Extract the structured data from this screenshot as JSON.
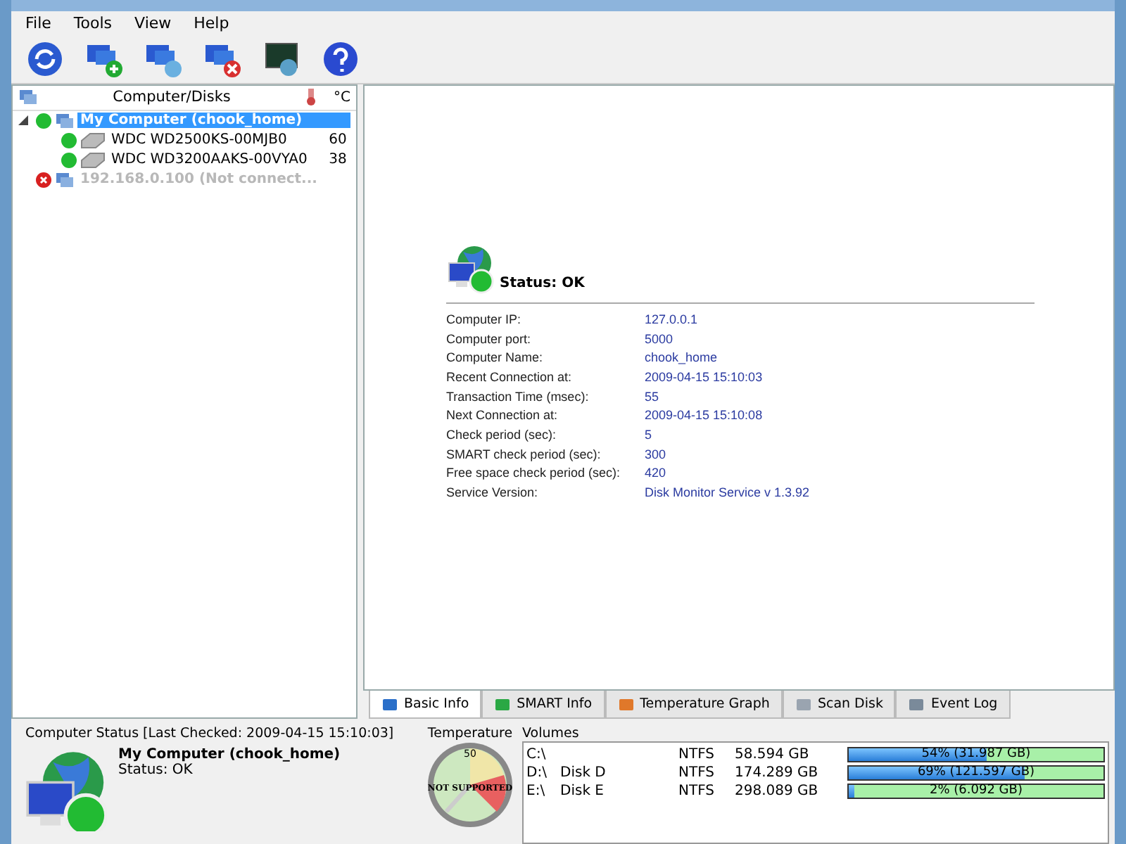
{
  "menu": [
    "File",
    "Tools",
    "View",
    "Help"
  ],
  "toolbar": [
    {
      "kind": "refresh"
    },
    {
      "kind": "add"
    },
    {
      "kind": "edit"
    },
    {
      "kind": "remove"
    },
    {
      "kind": "monitor"
    },
    {
      "kind": "help"
    }
  ],
  "tree": {
    "columns": [
      "Computer/Disks",
      "°C"
    ],
    "items": [
      {
        "label": "My Computer (chook_home)",
        "kind": "computer",
        "connected": true,
        "selected": true,
        "expanded": true,
        "children": [
          {
            "label": "WDC WD2500KS-00MJB0",
            "kind": "disk",
            "connected": true,
            "selected": false,
            "temp": "60"
          },
          {
            "label": "WDC WD3200AAKS-00VYA0",
            "kind": "disk",
            "connected": true,
            "selected": false,
            "temp": "38"
          }
        ]
      },
      {
        "label": "192.168.0.100 (Not connect...",
        "kind": "computer",
        "connected": false,
        "selected": false
      }
    ]
  },
  "info": {
    "status": "Status: OK",
    "rows": [
      {
        "label": "Computer IP:",
        "value": "127.0.0.1"
      },
      {
        "label": "Computer port:",
        "value": "5000"
      },
      {
        "label": "Computer Name:",
        "value": "chook_home"
      },
      {
        "label": "Recent Connection at:",
        "value": "2009-04-15 15:10:03"
      },
      {
        "label": "Transaction Time (msec):",
        "value": "55"
      },
      {
        "label": "Next Connection at:",
        "value": "2009-04-15 15:10:08"
      },
      {
        "label": "Check period (sec):",
        "value": "5"
      },
      {
        "label": "SMART check period (sec):",
        "value": "300"
      },
      {
        "label": "Free space check period (sec):",
        "value": "420"
      },
      {
        "label": "Service Version:",
        "value": "Disk Monitor Service v 1.3.92"
      }
    ]
  },
  "tabs": [
    {
      "label": "Basic Info",
      "selected": true,
      "color": "#2a6fc9"
    },
    {
      "label": "SMART Info",
      "selected": false,
      "color": "#2aa844"
    },
    {
      "label": "Temperature Graph",
      "selected": false,
      "color": "#e0782a"
    },
    {
      "label": "Scan Disk",
      "selected": false,
      "color": "#9aa4b0"
    },
    {
      "label": "Event Log",
      "selected": false,
      "color": "#7a8a9a"
    }
  ],
  "computer_status": {
    "title": "Computer Status [Last Checked: 2009-04-15 15:10:03]",
    "name": "My Computer (chook_home)",
    "status": "Status: OK"
  },
  "temperature": {
    "title": "Temperature",
    "tick": "50",
    "reading": "NOT SUPPORTED"
  },
  "volumes": {
    "title": "Volumes",
    "rows": [
      {
        "drive": "C:\\",
        "label": "",
        "fs": "NTFS",
        "size": "58.594 GB",
        "level": 0.54,
        "usage": "54% (31.987 GB)"
      },
      {
        "drive": "D:\\",
        "label": "Disk D",
        "fs": "NTFS",
        "size": "174.289 GB",
        "level": 0.69,
        "usage": "69% (121.597 GB)"
      },
      {
        "drive": "E:\\",
        "label": "Disk E",
        "fs": "NTFS",
        "size": "298.089 GB",
        "level": 0.02,
        "usage": "2% (6.092 GB)"
      }
    ]
  }
}
